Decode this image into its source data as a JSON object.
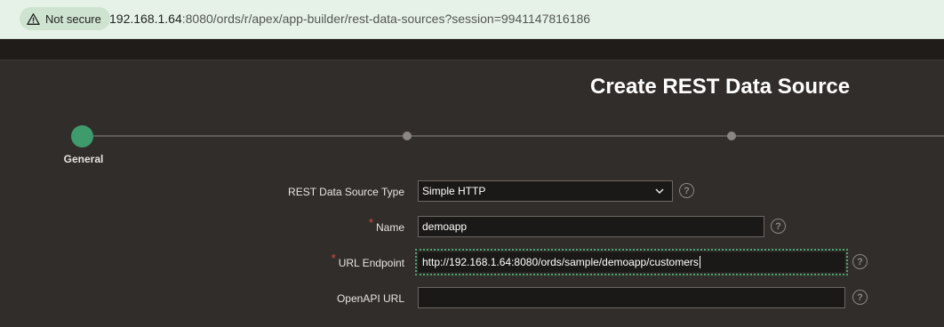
{
  "browser": {
    "security_label": "Not secure",
    "url_host": "192.168.1.64",
    "url_rest": ":8080/ords/r/apex/app-builder/rest-data-sources?session=9941147816186"
  },
  "page": {
    "title": "Create REST Data Source"
  },
  "wizard": {
    "steps": [
      {
        "label": "General",
        "state": "current"
      },
      {
        "label": "",
        "state": "upcoming"
      },
      {
        "label": "",
        "state": "upcoming"
      }
    ]
  },
  "form": {
    "source_type": {
      "label": "REST Data Source Type",
      "value": "Simple HTTP",
      "required": false
    },
    "name": {
      "label": "Name",
      "value": "demoapp",
      "required": true,
      "required_marker": "*"
    },
    "url_endpoint": {
      "label": "URL Endpoint",
      "value": "http://192.168.1.64:8080/ords/sample/demoapp/customers",
      "required": true,
      "required_marker": "*"
    },
    "openapi_url": {
      "label": "OpenAPI URL",
      "value": "",
      "required": false
    }
  },
  "help_icon_glyph": "?",
  "colors": {
    "accent": "#3e9b6b",
    "required": "#e04a3d",
    "background": "#312d2a",
    "browser_bar": "#e6f2e7"
  }
}
